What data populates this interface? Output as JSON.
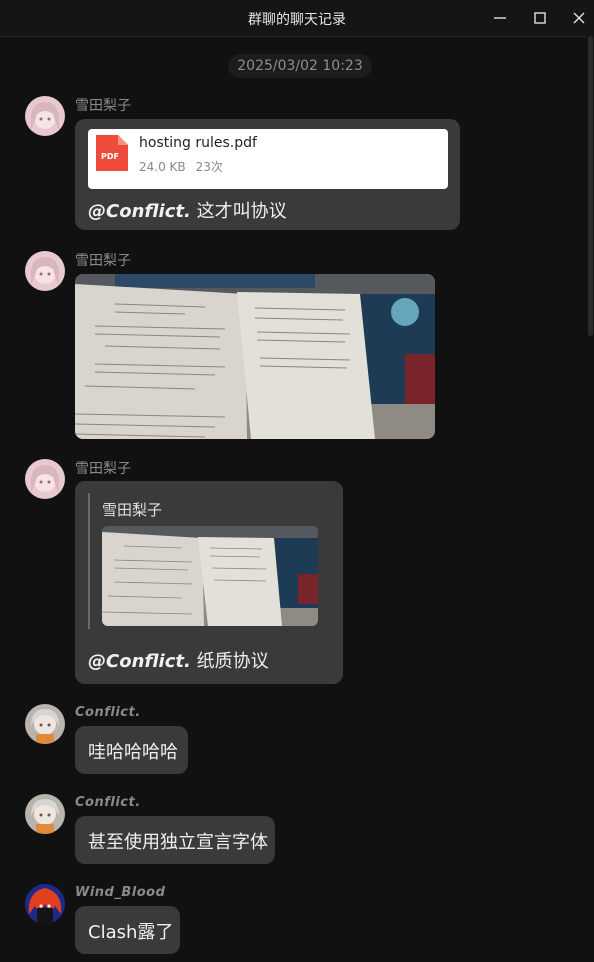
{
  "window": {
    "title": "群聊的聊天记录",
    "controls": [
      "minimize-icon",
      "maximize-icon",
      "close-icon"
    ]
  },
  "timestamp": "2025/03/02 10:23",
  "messages": [
    {
      "sender": "雪田梨子",
      "file": {
        "name": "hosting rules.pdf",
        "size": "24.0 KB",
        "count": "23次",
        "icon": "pdf-file-icon",
        "icon_label": "PDF"
      },
      "mention": "@Conflict.",
      "text": " 这才叫协议"
    },
    {
      "sender": "雪田梨子",
      "image": "photo-of-printed-rules"
    },
    {
      "sender": "雪田梨子",
      "quote": {
        "sender": "雪田梨子",
        "image": "photo-of-printed-rules"
      },
      "mention": "@Conflict.",
      "text": " 纸质协议"
    },
    {
      "sender": "Conflict.",
      "text": "哇哈哈哈哈"
    },
    {
      "sender": "Conflict.",
      "text": "甚至使用独立宣言字体"
    },
    {
      "sender": "Wind_Blood",
      "text": "Clash露了"
    }
  ],
  "colors": {
    "background": "#111111",
    "bubble": "#3a3a3a",
    "sender": "#8a8a8a",
    "pdf_red": "#ee4b3a"
  }
}
